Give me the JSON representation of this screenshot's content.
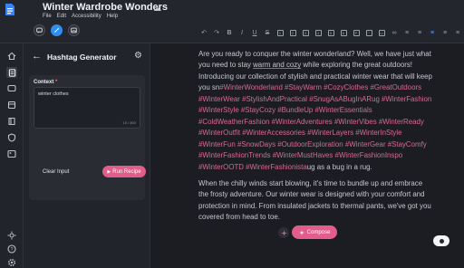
{
  "header": {
    "title": "Winter Wardrobe Wonders",
    "menus": [
      "File",
      "Edit",
      "Accessibility",
      "Help"
    ],
    "accent": "#2f8ff0"
  },
  "toolbar": {
    "items": [
      "undo-icon",
      "redo-icon",
      "bold-icon",
      "italic-icon",
      "underline-icon",
      "strikethrough-icon",
      "heading-1-icon",
      "heading-2-icon",
      "heading-3-icon",
      "heading-4-icon",
      "heading-5-icon",
      "heading-6-icon",
      "paragraph-icon",
      "quote-icon",
      "code-icon",
      "link-icon",
      "bullet-list-icon",
      "ordered-list-icon",
      "align-left-icon",
      "align-center-icon",
      "align-right-icon"
    ],
    "box_labels": [
      "1",
      "2",
      "3",
      "4",
      "5",
      "6",
      "P",
      "“",
      "<>"
    ]
  },
  "rail": {
    "top": [
      "home-icon",
      "document-icon",
      "chat-icon",
      "template-icon",
      "library-icon",
      "shield-icon",
      "image-icon"
    ],
    "bottom": [
      "theme-icon",
      "help-icon",
      "settings-icon"
    ]
  },
  "panel": {
    "title": "Hashtag Generator",
    "context_label": "Context",
    "context_required": "*",
    "context_value": "winter clothes",
    "char_count": "15 / 800",
    "clear_label": "Clear Input",
    "run_label": "Run Recipe"
  },
  "editor": {
    "compose_label": "Compose",
    "paragraph1": [
      {
        "t": "Are you ready to conquer the winter wonderland? Well, we have just what you need to stay "
      },
      {
        "t": "warm and cozy",
        "hl": true
      },
      {
        "t": " while exploring the great outdoors! Introducing our collection of stylish and practical winter wear that will keep you sn"
      },
      {
        "t": "#WinterWonderland #StayWarm #CozyClothes #GreatOutdoors #WinterWear #StylishAndPractical #SnugAsABugInARug #WinterFashion #WinterStyle #StayCozy #BundleUp #WinterEssentials #ColdWeatherFashion #WinterAdventures #WinterVibes #WinterReady #WinterOutfit #WinterAccessories #WinterLayers #WinterInStyle #WinterFun #SnowDays #OutdoorExploration #WinterGear #StayComfy #WinterFashionTrends #WinterMustHaves #WinterFashionInspo #WinterOOTD #WinterFashionista",
        "tag": true
      },
      {
        "t": "ug as a bug in a rug."
      }
    ],
    "paragraph2": "When the chilly winds start blowing, it's time to bundle up and embrace the frosty adventure. Our winter wear is designed with your comfort and protection in mind. From insulated jackets to thermal pants, we've got you covered from head to toe."
  }
}
